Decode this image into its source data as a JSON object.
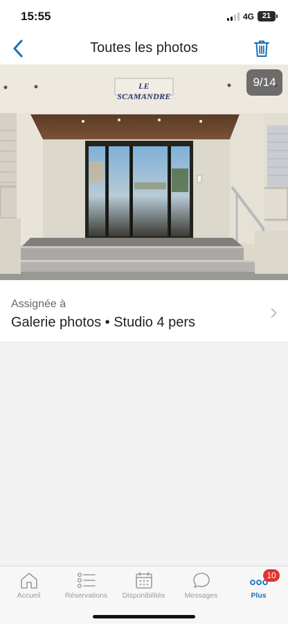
{
  "status_bar": {
    "time": "15:55",
    "network": "4G",
    "battery": "21",
    "signal_bars_active": 2,
    "signal_bars_total": 4
  },
  "nav": {
    "title": "Toutes les photos",
    "back_icon": "chevron-left-icon",
    "delete_icon": "trash-icon",
    "accent_color": "#1a6fb5"
  },
  "photo": {
    "counter": "9/14",
    "sign_text": "LE SCAMANDRE"
  },
  "assignment": {
    "label": "Assignée à",
    "value": "Galerie photos • Studio 4 pers",
    "chevron_icon": "chevron-right-icon"
  },
  "tab_bar": {
    "tabs": [
      {
        "label": "Accueil",
        "icon": "home-icon"
      },
      {
        "label": "Réservations",
        "icon": "list-icon"
      },
      {
        "label": "Disponibilités",
        "icon": "calendar-icon"
      },
      {
        "label": "Messages",
        "icon": "chat-bubble-icon"
      },
      {
        "label": "Plus",
        "icon": "more-dots-icon",
        "badge": "10",
        "active": true
      }
    ],
    "active_color": "#1a6fb5",
    "badge_color": "#e0332f"
  }
}
